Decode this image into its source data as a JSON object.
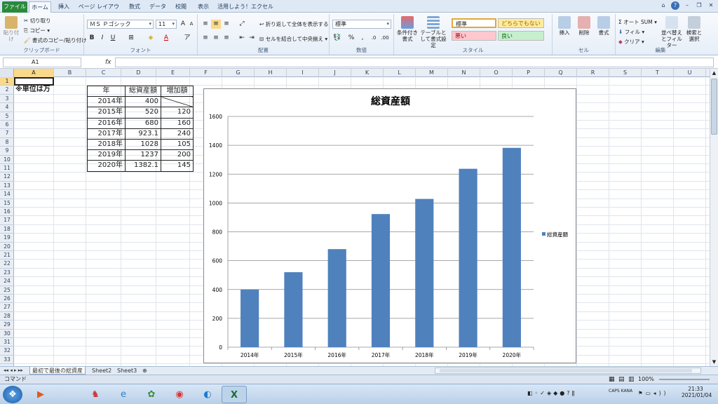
{
  "ribbon_tabs": [
    "ファイル",
    "ホーム",
    "挿入",
    "ページ レイアウト",
    "数式",
    "データ",
    "校閲",
    "表示",
    "活用しよう！エクセル"
  ],
  "ribbon": {
    "clipboard": {
      "paste": "貼り付け",
      "cut": "切り取り",
      "copy": "コピー",
      "format_copy": "書式のコピー/貼り付け",
      "label": "クリップボード"
    },
    "font": {
      "name": "ＭＳ Ｐゴシック",
      "size": "11",
      "bold": "B",
      "italic": "I",
      "underline": "U",
      "label": "フォント"
    },
    "alignment": {
      "wrap": "折り返して全体を表示する",
      "merge": "セルを結合して中央揃え",
      "label": "配置"
    },
    "number": {
      "format": "標準",
      "label": "数値"
    },
    "styles": {
      "conditional": "条件付き書式",
      "table": "テーブルとして書式設定",
      "normal": "標準",
      "neutral": "どちらでもない",
      "bad": "悪い",
      "good": "良い",
      "label": "スタイル"
    },
    "cells": {
      "insert": "挿入",
      "delete": "削除",
      "format": "書式",
      "label": "セル"
    },
    "editing": {
      "autosum": "オート SUM",
      "fill": "フィル",
      "clear": "クリア",
      "sort": "並べ替えとフィルター",
      "find": "検索と選択",
      "label": "編集"
    }
  },
  "namebox": "A1",
  "fx_label": "fx",
  "columns": [
    "A",
    "B",
    "C",
    "D",
    "E",
    "F",
    "G",
    "H",
    "I",
    "J",
    "K",
    "L",
    "M",
    "N",
    "O",
    "P",
    "Q",
    "R",
    "S",
    "T",
    "U"
  ],
  "rows": [
    "1",
    "2",
    "3",
    "4",
    "5",
    "6",
    "7",
    "8",
    "9",
    "10",
    "11",
    "12",
    "13",
    "14",
    "15",
    "16",
    "17",
    "18",
    "19",
    "20",
    "21",
    "22",
    "23",
    "24",
    "25",
    "26",
    "27",
    "28",
    "29",
    "30",
    "31",
    "32",
    "33"
  ],
  "note": "※単位は万",
  "table": {
    "headers": [
      "年",
      "総資産額",
      "増加額"
    ],
    "rows": [
      [
        "2014年",
        "400",
        ""
      ],
      [
        "2015年",
        "520",
        "120"
      ],
      [
        "2016年",
        "680",
        "160"
      ],
      [
        "2017年",
        "923.1",
        "240"
      ],
      [
        "2018年",
        "1028",
        "105"
      ],
      [
        "2019年",
        "1237",
        "200"
      ],
      [
        "2020年",
        "1382.1",
        "145"
      ]
    ]
  },
  "chart_data": {
    "type": "bar",
    "title": "総資産額",
    "categories": [
      "2014年",
      "2015年",
      "2016年",
      "2017年",
      "2018年",
      "2019年",
      "2020年"
    ],
    "series": [
      {
        "name": "総資産額",
        "values": [
          400,
          520,
          680,
          923.1,
          1028,
          1237,
          1382.1
        ],
        "color": "#4f81bd"
      }
    ],
    "ylim": [
      0,
      1600
    ],
    "yticks": [
      "0",
      "200",
      "400",
      "600",
      "800",
      "1000",
      "1200",
      "1400",
      "1600"
    ],
    "grid": true,
    "legend": "right"
  },
  "sheet_tabs": [
    "最初で最後の総資産",
    "Sheet2",
    "Sheet3"
  ],
  "status": {
    "mode": "コマンド",
    "zoom": "100%"
  },
  "taskbar": {
    "time": "21:33",
    "date": "2021/01/04"
  }
}
